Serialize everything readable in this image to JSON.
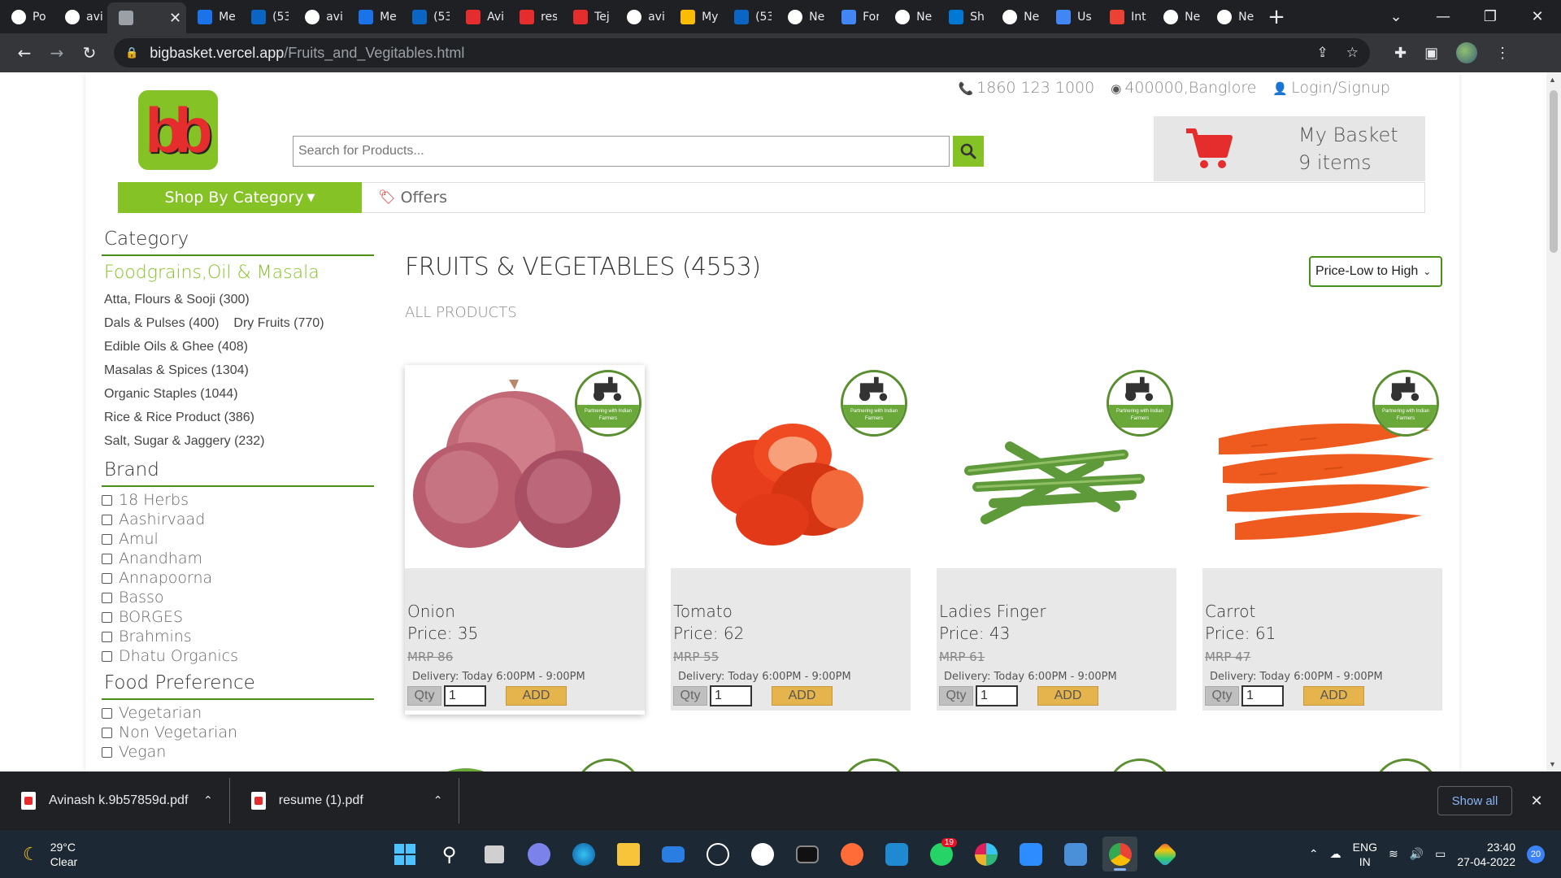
{
  "browser": {
    "tabs": [
      {
        "label": "Po",
        "icon": "notion-icon",
        "color": "#ffffff"
      },
      {
        "label": "avi",
        "icon": "github-icon",
        "color": "#ffffff"
      },
      {
        "label": "",
        "icon": "chrome-page-icon",
        "color": "#9aa0a6",
        "active": true
      },
      {
        "label": "Me",
        "icon": "meet-icon",
        "color": "#1a73e8"
      },
      {
        "label": "(53",
        "icon": "linkedin-icon",
        "color": "#0a66c2"
      },
      {
        "label": "avi",
        "icon": "github-icon",
        "color": "#ffffff"
      },
      {
        "label": "Me",
        "icon": "meet-icon",
        "color": "#1a73e8"
      },
      {
        "label": "(53",
        "icon": "linkedin-icon",
        "color": "#0a66c2"
      },
      {
        "label": "Avi",
        "icon": "pdf-icon",
        "color": "#e52d2d"
      },
      {
        "label": "res",
        "icon": "pdf-icon",
        "color": "#e52d2d"
      },
      {
        "label": "Tej",
        "icon": "pdf-icon",
        "color": "#e52d2d"
      },
      {
        "label": "avi",
        "icon": "github-icon",
        "color": "#ffffff"
      },
      {
        "label": "My",
        "icon": "drive-icon",
        "color": "#fbbc04"
      },
      {
        "label": "(53",
        "icon": "linkedin-icon",
        "color": "#0a66c2"
      },
      {
        "label": "Ne",
        "icon": "netlify-icon",
        "color": "#ffffff"
      },
      {
        "label": "For",
        "icon": "form-icon",
        "color": "#4285f4"
      },
      {
        "label": "Ne",
        "icon": "netlify-icon",
        "color": "#ffffff"
      },
      {
        "label": "Sh",
        "icon": "skype-icon",
        "color": "#0078d4"
      },
      {
        "label": "Ne",
        "icon": "netlify-icon",
        "color": "#ffffff"
      },
      {
        "label": "Us",
        "icon": "loader-icon",
        "color": "#4285f4"
      },
      {
        "label": "Int",
        "icon": "gmail-icon",
        "color": "#ea4335"
      },
      {
        "label": "Ne",
        "icon": "netlify-icon",
        "color": "#ffffff"
      },
      {
        "label": "Ne",
        "icon": "netlify-icon",
        "color": "#ffffff"
      }
    ],
    "url_host": "bigbasket.vercel.app",
    "url_path": "/Fruits_and_Vegitables.html"
  },
  "header": {
    "phone": "1860 123 1000",
    "location": "400000,Banglore",
    "login": "Login/Signup",
    "logo_text": "bb",
    "search_placeholder": "Search for Products...",
    "basket_title": "My Basket",
    "basket_count": "9 items",
    "shop_by_category": "Shop By Category",
    "offers": "Offers"
  },
  "sidebar": {
    "category_heading": "Category",
    "category_group": "Foodgrains,Oil & Masala",
    "categories": [
      [
        "Atta, Flours & Sooji (300)"
      ],
      [
        "Dals & Pulses (400)",
        "Dry Fruits (770)"
      ],
      [
        "Edible Oils & Ghee (408)"
      ],
      [
        "Masalas & Spices (1304)"
      ],
      [
        "Organic Staples (1044)"
      ],
      [
        "Rice & Rice Product (386)"
      ],
      [
        "Salt, Sugar & Jaggery (232)"
      ]
    ],
    "brand_heading": "Brand",
    "brands": [
      "18 Herbs",
      "Aashirvaad",
      "Amul",
      "Anandham",
      "Annapoorna",
      "Basso",
      "BORGES",
      "Brahmins",
      "Dhatu Organics"
    ],
    "food_pref_heading": "Food Preference",
    "food_prefs": [
      "Vegetarian",
      "Non Vegetarian",
      "Vegan"
    ]
  },
  "main": {
    "title": "FRUITS & VEGETABLES (4553)",
    "subtitle": "ALL PRODUCTS",
    "sort_selected": "Price-Low to High",
    "products": [
      {
        "name": "Onion",
        "price": "Price: 35",
        "mrp": "MRP 86",
        "delivery": "Delivery: Today 6:00PM - 9:00PM",
        "qty_label": "Qty",
        "qty": "1",
        "add": "ADD",
        "image": "onion"
      },
      {
        "name": "Tomato",
        "price": "Price: 62",
        "mrp": "MRP 55",
        "delivery": "Delivery: Today 6:00PM - 9:00PM",
        "qty_label": "Qty",
        "qty": "1",
        "add": "ADD",
        "image": "tomato"
      },
      {
        "name": "Ladies Finger",
        "price": "Price: 43",
        "mrp": "MRP 61",
        "delivery": "Delivery: Today 6:00PM - 9:00PM",
        "qty_label": "Qty",
        "qty": "1",
        "add": "ADD",
        "image": "okra"
      },
      {
        "name": "Carrot",
        "price": "Price: 61",
        "mrp": "MRP 47",
        "delivery": "Delivery: Today 6:00PM - 9:00PM",
        "qty_label": "Qty",
        "qty": "1",
        "add": "ADD",
        "image": "carrot"
      }
    ],
    "badge_text": "Partnering with Indian Farmers"
  },
  "downloads": {
    "items": [
      "Avinash k.9b57859d.pdf",
      "resume (1).pdf"
    ],
    "show_all": "Show all"
  },
  "taskbar": {
    "temperature": "29°C",
    "condition": "Clear",
    "lang_1": "ENG",
    "lang_2": "IN",
    "time": "23:40",
    "date": "27-04-2022",
    "notifications": "20",
    "whatsapp_badge": "19"
  },
  "colors": {
    "brand_green": "#84c225",
    "brand_red": "#e52d2d",
    "dark_green": "#4a8f18",
    "add_button": "#e6b44c"
  }
}
